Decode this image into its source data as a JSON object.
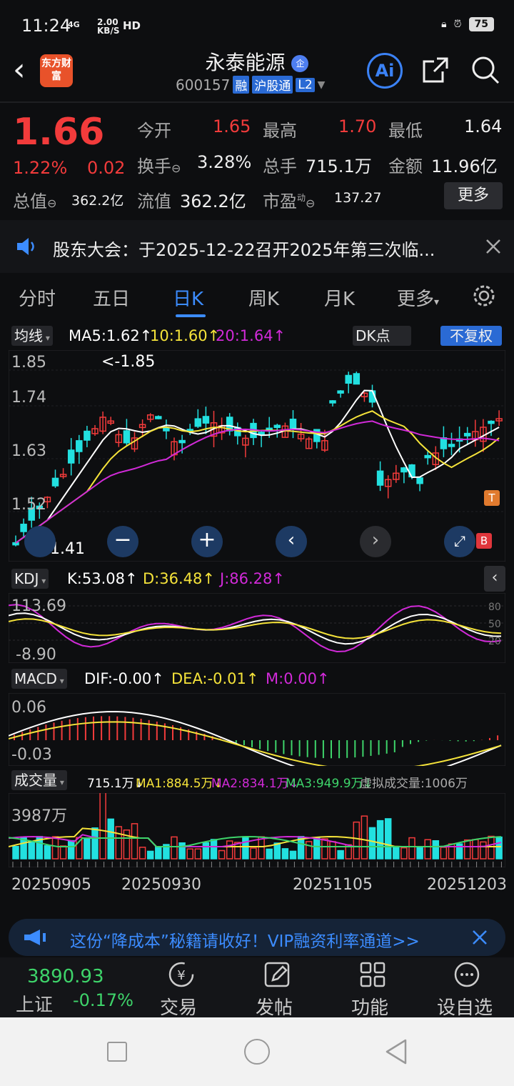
{
  "status": {
    "time": "11:24",
    "net_type": "4G",
    "speed": "2.00",
    "speed_unit": "KB/S",
    "hd": "HD",
    "battery": "75"
  },
  "header": {
    "logo_text": "东方财富",
    "name": "永泰能源",
    "name_badge": "企",
    "code": "600157",
    "tags": [
      "融",
      "沪股通",
      "L2"
    ],
    "ai_label": "Ai"
  },
  "quote": {
    "price": "1.66",
    "pct": "1.22%",
    "change": "0.02",
    "open_label": "今开",
    "open": "1.65",
    "high_label": "最高",
    "high": "1.70",
    "low_label": "最低",
    "low": "1.64",
    "turnover_label": "换手",
    "turnover": "3.28%",
    "volume_label": "总手",
    "volume": "715.1万",
    "amount_label": "金额",
    "amount": "11.96亿",
    "mktcap_label": "总值",
    "mktcap": "362.2亿",
    "float_label": "流值",
    "float": "362.2亿",
    "pe_label": "市盈",
    "pe_sup": "动",
    "pe": "137.27",
    "more_label": "更多"
  },
  "notice": {
    "text": "股东大会：于2025-12-22召开2025年第三次临..."
  },
  "tabs": [
    "分时",
    "五日",
    "日K",
    "周K",
    "月K",
    "更多"
  ],
  "active_tab": 2,
  "chart": {
    "ma_select": "均线",
    "ma5": "MA5:1.62↑",
    "ma10": "10:1.60↑",
    "ma20": "20:1.64↑",
    "dk_label": "DK点",
    "fq_label": "不复权",
    "y_labels": [
      "1.85",
      "1.74",
      "1.63",
      "1.52"
    ],
    "max_label": "<-1.85",
    "min_label": "1.41",
    "kdj_select": "KDJ",
    "k": "K:53.08↑",
    "d": "D:36.48↑",
    "j": "J:86.28↑",
    "kdj_top": "113.69",
    "kdj_bottom": "-8.90",
    "kdj_r80": "80",
    "kdj_r50": "50",
    "kdj_r20": "20",
    "macd_select": "MACD",
    "dif": "DIF:-0.00↑",
    "dea": "DEA:-0.01↑",
    "m": "M:0.00↑",
    "macd_top": "0.06",
    "macd_bottom": "-0.03",
    "vol_select": "成交量",
    "vol": "715.1万↓",
    "vma1": "MA1:884.5万↓",
    "vma2": "MA2:834.1万↓",
    "vma3": "MA3:949.9万↓",
    "vvirtual": "虚拟成交量:1006万",
    "vol_top": "3987万",
    "dates": [
      "20250905",
      "20250930",
      "20251105",
      "20251203"
    ],
    "marker_t": "T",
    "marker_b": "B"
  },
  "ad": {
    "text": "这份“降成本”秘籍请收好！VIP融资利率通道>>"
  },
  "bottom_nav": {
    "index_value": "3890.93",
    "index_name": "上证",
    "index_change": "-0.17%",
    "items": [
      "交易",
      "发帖",
      "功能",
      "设自选"
    ]
  },
  "colors": {
    "up": "#f23b3b",
    "down": "#22e0e0",
    "accent": "#3c8cff",
    "ma5": "#ffffff",
    "ma10": "#f5e33a",
    "ma20": "#d12ad8"
  }
}
